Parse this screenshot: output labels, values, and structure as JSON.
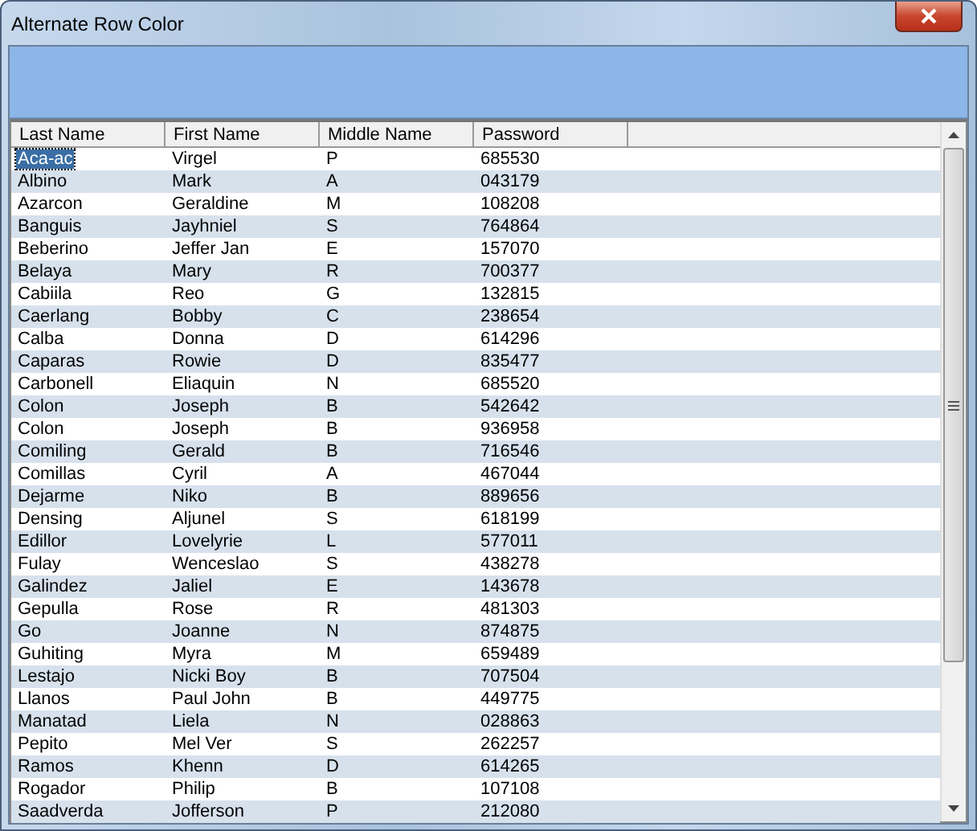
{
  "window": {
    "title": "Alternate Row Color"
  },
  "table": {
    "columns": [
      "Last Name",
      "First Name",
      "Middle Name",
      "Password"
    ],
    "rows": [
      {
        "cells": [
          "Aca-ac",
          "Virgel",
          "P",
          "685530"
        ],
        "selected": true
      },
      {
        "cells": [
          "Albino",
          "Mark",
          "A",
          "043179"
        ],
        "selected": false
      },
      {
        "cells": [
          "Azarcon",
          "Geraldine",
          "M",
          "108208"
        ],
        "selected": false
      },
      {
        "cells": [
          "Banguis",
          "Jayhniel",
          "S",
          "764864"
        ],
        "selected": false
      },
      {
        "cells": [
          "Beberino",
          "Jeffer Jan",
          "E",
          "157070"
        ],
        "selected": false
      },
      {
        "cells": [
          "Belaya",
          "Mary",
          "R",
          "700377"
        ],
        "selected": false
      },
      {
        "cells": [
          "Cabiila",
          "Reo",
          "G",
          "132815"
        ],
        "selected": false
      },
      {
        "cells": [
          "Caerlang",
          "Bobby",
          "C",
          "238654"
        ],
        "selected": false
      },
      {
        "cells": [
          "Calba",
          "Donna",
          "D",
          "614296"
        ],
        "selected": false
      },
      {
        "cells": [
          "Caparas",
          "Rowie",
          "D",
          "835477"
        ],
        "selected": false
      },
      {
        "cells": [
          "Carbonell",
          "Eliaquin",
          "N",
          "685520"
        ],
        "selected": false
      },
      {
        "cells": [
          "Colon",
          "Joseph",
          "B",
          "542642"
        ],
        "selected": false
      },
      {
        "cells": [
          "Colon",
          "Joseph",
          "B",
          "936958"
        ],
        "selected": false
      },
      {
        "cells": [
          "Comiling",
          "Gerald",
          "B",
          "716546"
        ],
        "selected": false
      },
      {
        "cells": [
          "Comillas",
          "Cyril",
          "A",
          "467044"
        ],
        "selected": false
      },
      {
        "cells": [
          "Dejarme",
          "Niko",
          "B",
          "889656"
        ],
        "selected": false
      },
      {
        "cells": [
          "Densing",
          "Aljunel",
          "S",
          "618199"
        ],
        "selected": false
      },
      {
        "cells": [
          "Edillor",
          "Lovelyrie",
          "L",
          "577011"
        ],
        "selected": false
      },
      {
        "cells": [
          "Fulay",
          "Wenceslao",
          "S",
          "438278"
        ],
        "selected": false
      },
      {
        "cells": [
          "Galindez",
          "Jaliel",
          "E",
          "143678"
        ],
        "selected": false
      },
      {
        "cells": [
          "Gepulla",
          "Rose",
          "R",
          "481303"
        ],
        "selected": false
      },
      {
        "cells": [
          "Go",
          "Joanne",
          "N",
          "874875"
        ],
        "selected": false
      },
      {
        "cells": [
          "Guhiting",
          "Myra",
          "M",
          "659489"
        ],
        "selected": false
      },
      {
        "cells": [
          "Lestajo",
          "Nicki Boy",
          "B",
          "707504"
        ],
        "selected": false
      },
      {
        "cells": [
          "Llanos",
          "Paul John",
          "B",
          "449775"
        ],
        "selected": false
      },
      {
        "cells": [
          "Manatad",
          "Liela",
          "N",
          "028863"
        ],
        "selected": false
      },
      {
        "cells": [
          "Pepito",
          "Mel Ver",
          "S",
          "262257"
        ],
        "selected": false
      },
      {
        "cells": [
          "Ramos",
          "Khenn",
          "D",
          "614265"
        ],
        "selected": false
      },
      {
        "cells": [
          "Rogador",
          "Philip",
          "B",
          "107108"
        ],
        "selected": false
      },
      {
        "cells": [
          "Saadverda",
          "Jofferson",
          "P",
          "212080"
        ],
        "selected": false
      }
    ]
  }
}
